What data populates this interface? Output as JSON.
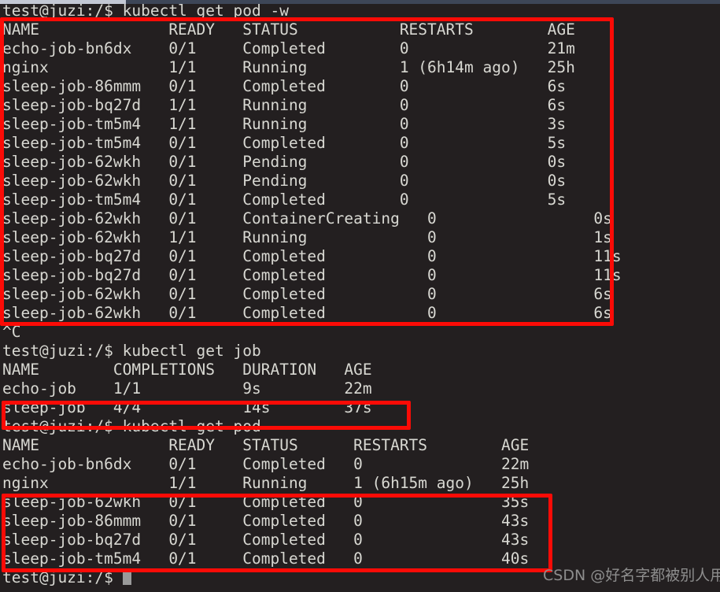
{
  "terminal": {
    "background_color": "#231f20",
    "foreground_color": "#d8d8d2",
    "highlight_color": "#fb0b06",
    "prompt": "test@juzi:/$",
    "lines": [
      "test@juzi:/$ kubectl get pod -w",
      "NAME              READY   STATUS           RESTARTS        AGE",
      "echo-job-bn6dx    0/1     Completed        0               21m",
      "nginx             1/1     Running          1 (6h14m ago)   25h",
      "sleep-job-86mmm   0/1     Completed        0               6s",
      "sleep-job-bq27d   1/1     Running          0               6s",
      "sleep-job-tm5m4   1/1     Running          0               3s",
      "sleep-job-tm5m4   0/1     Completed        0               5s",
      "sleep-job-62wkh   0/1     Pending          0               0s",
      "sleep-job-62wkh   0/1     Pending          0               0s",
      "sleep-job-tm5m4   0/1     Completed        0               5s",
      "sleep-job-62wkh   0/1     ContainerCreating   0                 0s",
      "sleep-job-62wkh   1/1     Running             0                 1s",
      "sleep-job-bq27d   0/1     Completed           0                 11s",
      "sleep-job-bq27d   0/1     Completed           0                 11s",
      "sleep-job-62wkh   0/1     Completed           0                 6s",
      "sleep-job-62wkh   0/1     Completed           0                 6s",
      "^C",
      "test@juzi:/$ kubectl get job",
      "NAME        COMPLETIONS   DURATION   AGE",
      "echo-job    1/1           9s         22m",
      "sleep-job   4/4           14s        37s",
      "test@juzi:/$ kubectl get pod",
      "NAME              READY   STATUS      RESTARTS        AGE",
      "echo-job-bn6dx    0/1     Completed   0               22m",
      "nginx             1/1     Running     1 (6h15m ago)   25h",
      "sleep-job-62wkh   0/1     Completed   0               35s",
      "sleep-job-86mmm   0/1     Completed   0               43s",
      "sleep-job-bq27d   0/1     Completed   0               43s",
      "sleep-job-tm5m4   0/1     Completed   0               40s",
      "test@juzi:/$ "
    ]
  },
  "commands": {
    "watch_pods": "kubectl get pod -w",
    "get_jobs": "kubectl get job",
    "get_pods": "kubectl get pod",
    "interrupt": "^C"
  },
  "pod_table_watch": {
    "headers": [
      "NAME",
      "READY",
      "STATUS",
      "RESTARTS",
      "AGE"
    ],
    "rows": [
      [
        "echo-job-bn6dx",
        "0/1",
        "Completed",
        "0",
        "21m"
      ],
      [
        "nginx",
        "1/1",
        "Running",
        "1 (6h14m ago)",
        "25h"
      ],
      [
        "sleep-job-86mmm",
        "0/1",
        "Completed",
        "0",
        "6s"
      ],
      [
        "sleep-job-bq27d",
        "1/1",
        "Running",
        "0",
        "6s"
      ],
      [
        "sleep-job-tm5m4",
        "1/1",
        "Running",
        "0",
        "3s"
      ],
      [
        "sleep-job-tm5m4",
        "0/1",
        "Completed",
        "0",
        "5s"
      ],
      [
        "sleep-job-62wkh",
        "0/1",
        "Pending",
        "0",
        "0s"
      ],
      [
        "sleep-job-62wkh",
        "0/1",
        "Pending",
        "0",
        "0s"
      ],
      [
        "sleep-job-tm5m4",
        "0/1",
        "Completed",
        "0",
        "5s"
      ],
      [
        "sleep-job-62wkh",
        "0/1",
        "ContainerCreating",
        "0",
        "0s"
      ],
      [
        "sleep-job-62wkh",
        "1/1",
        "Running",
        "0",
        "1s"
      ],
      [
        "sleep-job-bq27d",
        "0/1",
        "Completed",
        "0",
        "11s"
      ],
      [
        "sleep-job-bq27d",
        "0/1",
        "Completed",
        "0",
        "11s"
      ],
      [
        "sleep-job-62wkh",
        "0/1",
        "Completed",
        "0",
        "6s"
      ],
      [
        "sleep-job-62wkh",
        "0/1",
        "Completed",
        "0",
        "6s"
      ]
    ]
  },
  "job_table": {
    "headers": [
      "NAME",
      "COMPLETIONS",
      "DURATION",
      "AGE"
    ],
    "rows": [
      [
        "echo-job",
        "1/1",
        "9s",
        "22m"
      ],
      [
        "sleep-job",
        "4/4",
        "14s",
        "37s"
      ]
    ]
  },
  "pod_table_final": {
    "headers": [
      "NAME",
      "READY",
      "STATUS",
      "RESTARTS",
      "AGE"
    ],
    "rows": [
      [
        "echo-job-bn6dx",
        "0/1",
        "Completed",
        "0",
        "22m"
      ],
      [
        "nginx",
        "1/1",
        "Running",
        "1 (6h15m ago)",
        "25h"
      ],
      [
        "sleep-job-62wkh",
        "0/1",
        "Completed",
        "0",
        "35s"
      ],
      [
        "sleep-job-86mmm",
        "0/1",
        "Completed",
        "0",
        "43s"
      ],
      [
        "sleep-job-bq27d",
        "0/1",
        "Completed",
        "0",
        "43s"
      ],
      [
        "sleep-job-tm5m4",
        "0/1",
        "Completed",
        "0",
        "40s"
      ]
    ]
  },
  "annotations": {
    "box_color": "#fb0b06",
    "box1_label": "watch-output-highlight",
    "box2_label": "sleep-job-row-highlight",
    "box3_label": "sleep-job-pods-highlight"
  },
  "watermark": {
    "text": "CSDN @好名字都被别人用了"
  }
}
